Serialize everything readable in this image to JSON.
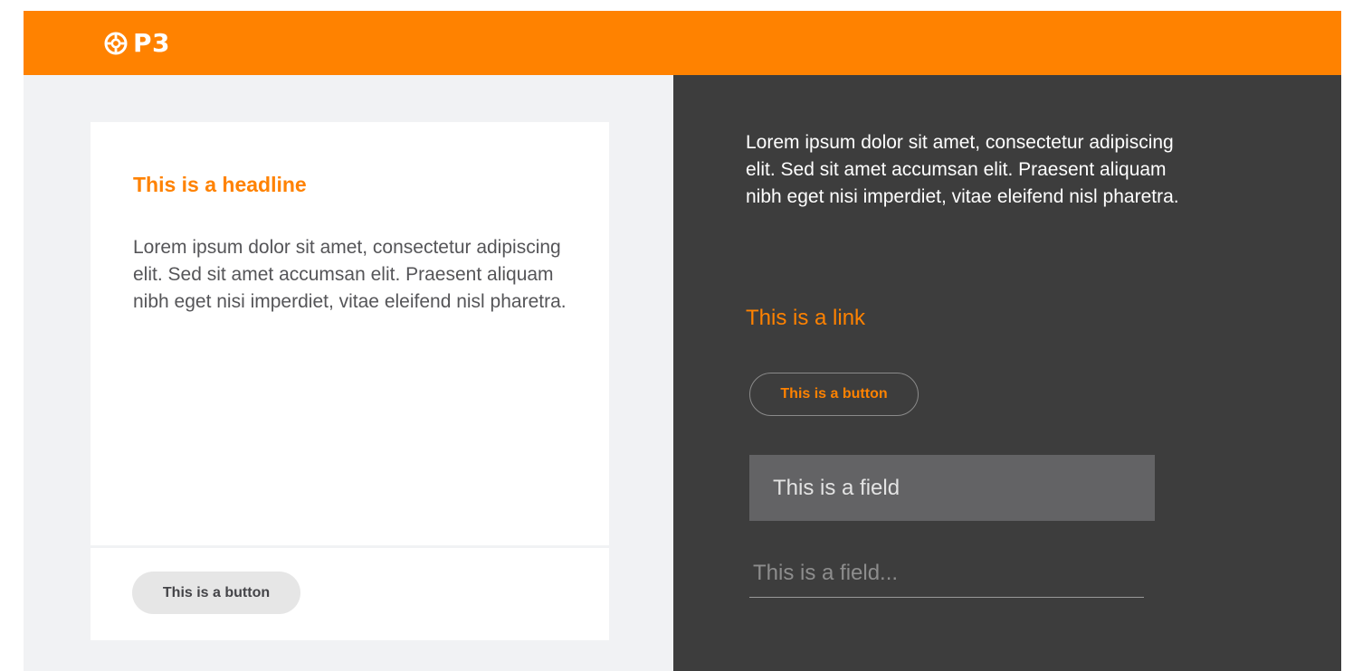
{
  "header": {
    "logo_text": "P3",
    "logo_icon": "gear-icon",
    "background_color": "#ff8200"
  },
  "card": {
    "headline": "This is a headline",
    "body": "Lorem ipsum dolor sit amet, consectetur adipiscing elit. Sed sit amet accumsan elit. Praesent aliquam nibh eget nisi imperdiet, vitae eleifend nisl pharetra.",
    "button_label": "This is a button"
  },
  "dark_panel": {
    "body": "Lorem ipsum dolor sit amet, consectetur adipiscing elit. Sed sit amet accumsan elit. Praesent aliquam nibh eget nisi imperdiet, vitae eleifend nisl pharetra.",
    "link_label": "This is a link",
    "button_label": "This is a button",
    "field_filled_placeholder": "This is a field",
    "field_underline_placeholder": "This is a field..."
  },
  "colors": {
    "accent": "#ff8200",
    "dark_background": "#3d3d3d",
    "light_background": "#f1f2f4"
  }
}
